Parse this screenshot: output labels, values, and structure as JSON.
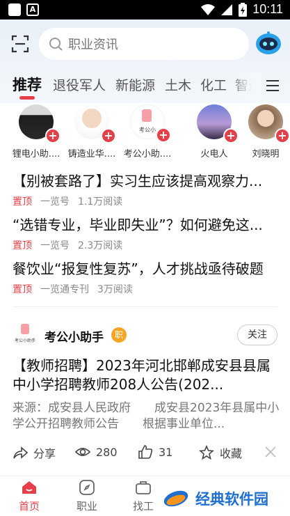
{
  "status_bar": {
    "time": "10:11",
    "icons": [
      "notification-square-icon",
      "a-app-icon",
      "wifi-icon",
      "signal-icon",
      "battery-charging-icon"
    ]
  },
  "header": {
    "search_placeholder": "职业资讯",
    "tabs": [
      "推荐",
      "退役军人",
      "新能源",
      "土木",
      "化工",
      "智造"
    ],
    "active_tab": "推荐"
  },
  "follow_suggestions": [
    {
      "name": "锂电小助...."
    },
    {
      "name": "铸造业华...."
    },
    {
      "name": "考公小助...."
    },
    {
      "name": "火电人"
    },
    {
      "name": "刘晓明"
    }
  ],
  "pinned": [
    {
      "title": "【别被套路了】实习生应该提高观察力...",
      "tag": "置顶",
      "source": "一览号",
      "reads": "1.1万阅读"
    },
    {
      "title": "“选错专业，毕业即失业”？如何避免这...",
      "tag": "置顶",
      "source": "一览号",
      "reads": "2.3万阅读"
    },
    {
      "title": "餐饮业“报复性复苏”，人才挑战亟待破题",
      "tag": "置顶",
      "source": "一览通专刊",
      "reads": "3万阅读"
    }
  ],
  "article": {
    "author": "考公小助手",
    "author_logo_text": "考公小助手",
    "badge": "职",
    "follow_label": "关注",
    "title": "【教师招聘】2023年河北邯郸成安县县属中小学招聘教师208人公告(202...",
    "excerpt": "来源：成安县人民政府　　成安县2023年县属中小学公开招聘教师公告　　根据事业单位...",
    "share_label": "分享",
    "views": "280",
    "likes": "31",
    "collect_label": "收藏"
  },
  "bottom_nav": [
    {
      "label": "首页",
      "active": true
    },
    {
      "label": "职业",
      "active": false
    },
    {
      "label": "找工",
      "active": false
    }
  ],
  "watermark": {
    "text": "经典软件园"
  },
  "colors": {
    "accent": "#e5404a",
    "badge": "#f5a623",
    "watermark": "#1f6fd1"
  }
}
